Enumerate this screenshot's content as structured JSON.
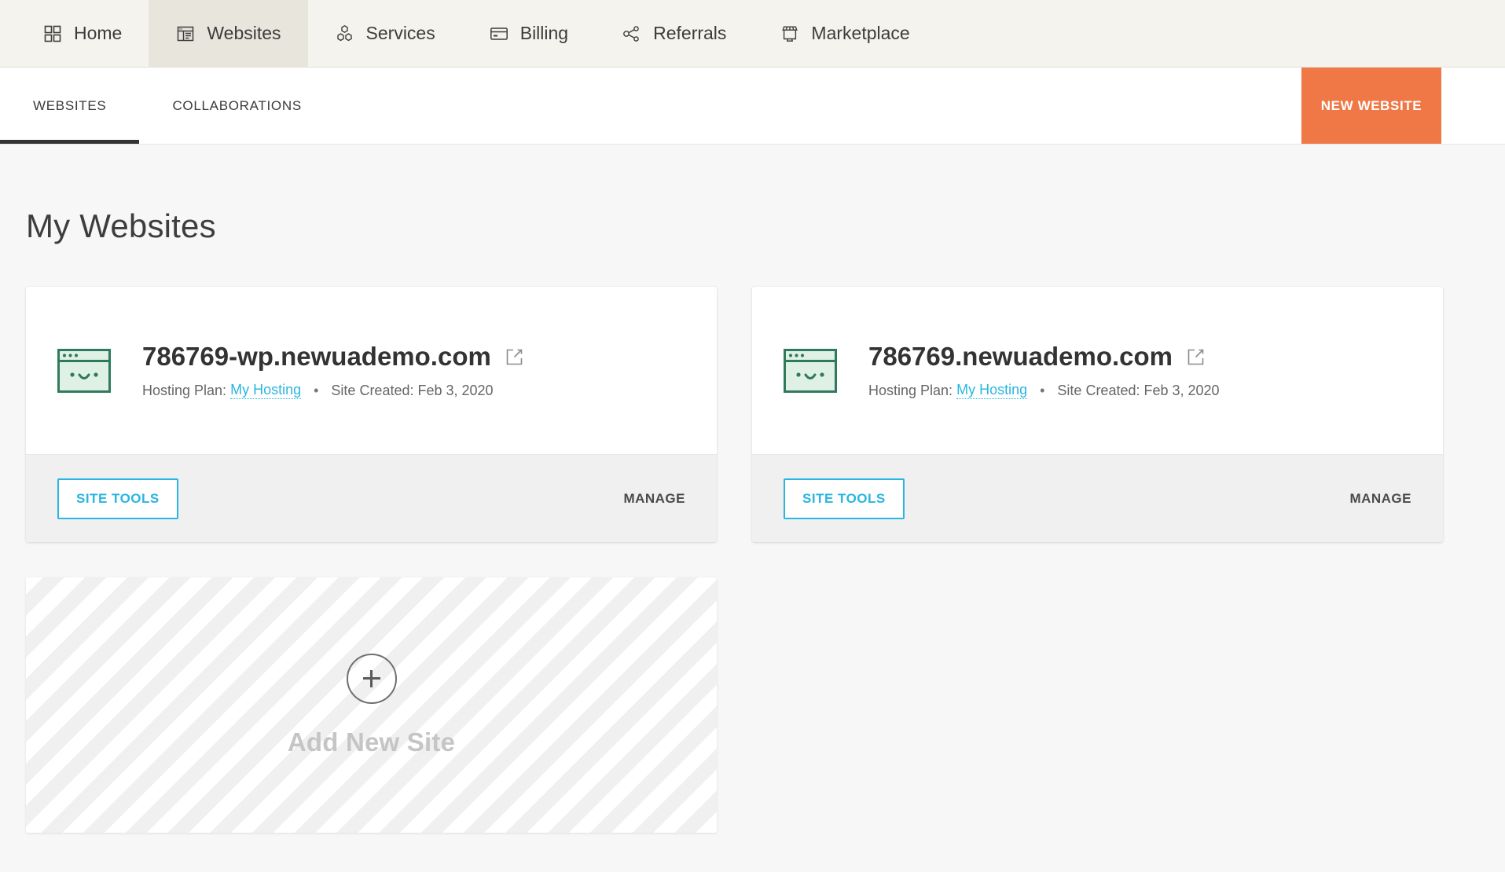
{
  "topnav": {
    "items": [
      {
        "label": "Home",
        "icon": "grid-icon",
        "active": false
      },
      {
        "label": "Websites",
        "icon": "browser-icon",
        "active": true
      },
      {
        "label": "Services",
        "icon": "hexagons-icon",
        "active": false
      },
      {
        "label": "Billing",
        "icon": "credit-card-icon",
        "active": false
      },
      {
        "label": "Referrals",
        "icon": "share-nodes-icon",
        "active": false
      },
      {
        "label": "Marketplace",
        "icon": "storefront-icon",
        "active": false
      }
    ]
  },
  "subnav": {
    "tabs": [
      {
        "label": "WEBSITES",
        "active": true
      },
      {
        "label": "COLLABORATIONS",
        "active": false
      }
    ],
    "new_website_label": "NEW WEBSITE"
  },
  "main": {
    "page_title": "My Websites",
    "meta_labels": {
      "hosting_plan_prefix": "Hosting Plan:",
      "site_created_prefix": "Site Created:",
      "separator": "•"
    },
    "cards": [
      {
        "domain": "786769-wp.newuademo.com",
        "hosting_plan_prefix": "Hosting Plan:",
        "hosting_plan": "My Hosting",
        "separator": "•",
        "site_created": "Site Created: Feb 3, 2020",
        "site_tools_label": "SITE TOOLS",
        "manage_label": "MANAGE",
        "favicon": "site-smiley-browser-icon",
        "external_link": "external-link-icon"
      },
      {
        "domain": "786769.newuademo.com",
        "hosting_plan_prefix": "Hosting Plan:",
        "hosting_plan": "My Hosting",
        "separator": "•",
        "site_created": "Site Created: Feb 3, 2020",
        "site_tools_label": "SITE TOOLS",
        "manage_label": "MANAGE",
        "favicon": "site-smiley-browser-icon",
        "external_link": "external-link-icon"
      }
    ],
    "add_card": {
      "label": "Add New Site",
      "icon": "plus-icon"
    }
  },
  "colors": {
    "topnav_bg": "#f5f3ed",
    "topnav_active_bg": "#e7e5dc",
    "accent_orange": "#ef7846",
    "accent_cyan": "#29b6e0",
    "page_bg": "#f7f7f7",
    "card_footer_bg": "#f0f0f0",
    "favicon_green_stroke": "#2f7a5e",
    "favicon_green_fill": "#dff0e5",
    "tab_underline": "#333333",
    "add_label_gray": "#c5c5c5"
  }
}
